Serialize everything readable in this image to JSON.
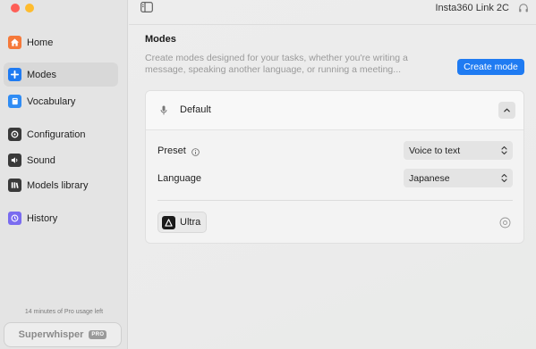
{
  "sidebar": {
    "items": [
      {
        "label": "Home",
        "icon": "home-icon",
        "color": "#f5793a"
      },
      {
        "label": "Modes",
        "icon": "plus-icon",
        "color": "#1f7bf2"
      },
      {
        "label": "Vocabulary",
        "icon": "book-icon",
        "color": "#2f8cf4"
      },
      {
        "label": "Configuration",
        "icon": "gear-icon",
        "color": "#3a3a3a"
      },
      {
        "label": "Sound",
        "icon": "speaker-icon",
        "color": "#3a3a3a"
      },
      {
        "label": "Models library",
        "icon": "library-icon",
        "color": "#3a3a3a"
      },
      {
        "label": "History",
        "icon": "history-icon",
        "color": "#7a6cf0"
      }
    ],
    "active_index": 1,
    "usage_note": "14 minutes of Pro usage left",
    "brand": "Superwhisper",
    "brand_badge": "PRO"
  },
  "topbar": {
    "device_name": "Insta360 Link 2C"
  },
  "modes": {
    "title": "Modes",
    "description": "Create modes designed for your tasks, whether you're writing a message, speaking another language, or running a meeting...",
    "create_button": "Create mode",
    "card": {
      "name": "Default",
      "preset_label": "Preset",
      "preset_value": "Voice to text",
      "language_label": "Language",
      "language_value": "Japanese",
      "model": "Ultra"
    }
  },
  "colors": {
    "accent": "#1f7bf2"
  }
}
